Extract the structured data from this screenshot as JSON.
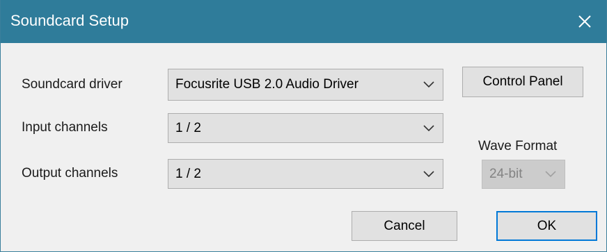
{
  "window": {
    "title": "Soundcard Setup"
  },
  "form": {
    "driver_label": "Soundcard driver",
    "driver_value": "Focusrite USB 2.0 Audio Driver",
    "input_label": "Input channels",
    "input_value": "1 / 2",
    "output_label": "Output channels",
    "output_value": "1 / 2",
    "wave_format_label": "Wave Format",
    "wave_format_value": "24-bit"
  },
  "buttons": {
    "control_panel": "Control Panel",
    "cancel": "Cancel",
    "ok": "OK"
  },
  "icons": {
    "close": "close-icon",
    "dropdown": "chevron-down-icon"
  },
  "colors": {
    "titlebar": "#2f7c9a",
    "dialog_bg": "#f0f0f0",
    "default_button_border": "#0078d7"
  }
}
